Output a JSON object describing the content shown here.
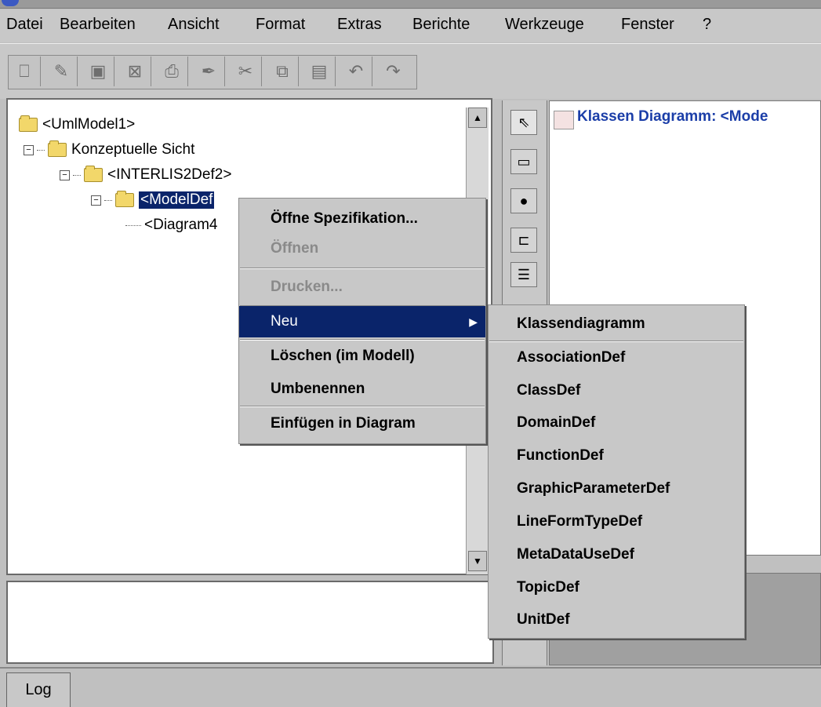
{
  "menubar": {
    "items": [
      "Datei",
      "Bearbeiten",
      "Ansicht",
      "Format",
      "Extras",
      "Berichte",
      "Werkzeuge",
      "Fenster",
      "?"
    ]
  },
  "tree": {
    "root": "<UmlModel1>",
    "child": "Konzeptuelle Sicht",
    "grandchild": "<INTERLIS2Def2>",
    "selected": "<ModelDef",
    "leaf": "<Diagram4"
  },
  "context_menu": {
    "items": [
      {
        "label": "Öffne Spezifikation...",
        "state": "enabled"
      },
      {
        "label": "Öffnen",
        "state": "disabled"
      },
      {
        "label": "Drucken...",
        "state": "disabled"
      },
      {
        "label": "Neu",
        "state": "highlighted",
        "submenu": true
      },
      {
        "label": "Löschen (im Modell)",
        "state": "enabled"
      },
      {
        "label": "Umbenennen",
        "state": "enabled"
      },
      {
        "label": "Einfügen in Diagram",
        "state": "enabled"
      }
    ]
  },
  "submenu": {
    "items": [
      "Klassendiagramm",
      "AssociationDef",
      "ClassDef",
      "DomainDef",
      "FunctionDef",
      "GraphicParameterDef",
      "LineFormTypeDef",
      "MetaDataUseDef",
      "TopicDef",
      "UnitDef"
    ]
  },
  "diagram": {
    "title": "Klassen Diagramm: <Mode"
  },
  "status": {
    "log_tab": "Log"
  },
  "colors": {
    "selection": "#0a246a",
    "diagram_title": "#1b3ea8"
  },
  "icons": {
    "toolbar": [
      "new-icon",
      "open-icon",
      "save-icon",
      "close-icon",
      "print-icon",
      "edit-icon",
      "cut-icon",
      "copy-icon",
      "paste-icon",
      "undo-icon",
      "redo-icon"
    ],
    "diagram_tools": [
      "pointer-icon",
      "note-icon",
      "actor-icon",
      "package-icon",
      "class-icon"
    ]
  }
}
